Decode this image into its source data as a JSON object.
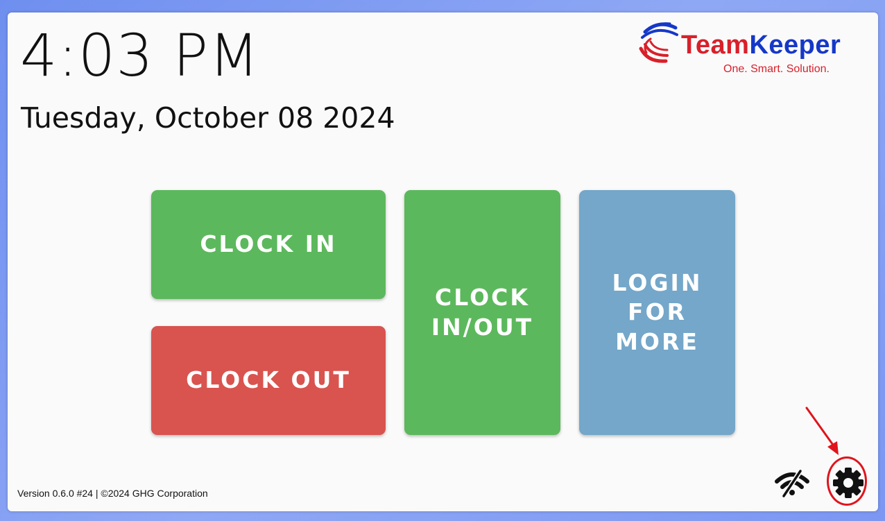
{
  "clock": {
    "time": "4:03 PM",
    "date": "Tuesday, October 08 2024"
  },
  "logo": {
    "name_part1": "Team",
    "name_part2": "Keeper",
    "tagline": "One. Smart. Solution.",
    "colors": {
      "red": "#d8202a",
      "blue": "#1538c8"
    }
  },
  "actions": {
    "clock_in": "CLOCK IN",
    "clock_out": "CLOCK OUT",
    "clock_in_out": "CLOCK\nIN/OUT",
    "login_more": "LOGIN\nFOR\nMORE"
  },
  "colors": {
    "green": "#5cb85c",
    "red": "#d9534f",
    "blue": "#74a7c9",
    "annotation": "#e0141c"
  },
  "footer": {
    "version": "Version 0.6.0 #24 | ©2024 GHG Corporation"
  },
  "status_icons": {
    "network": "wifi-off-icon",
    "settings": "gear-icon"
  }
}
